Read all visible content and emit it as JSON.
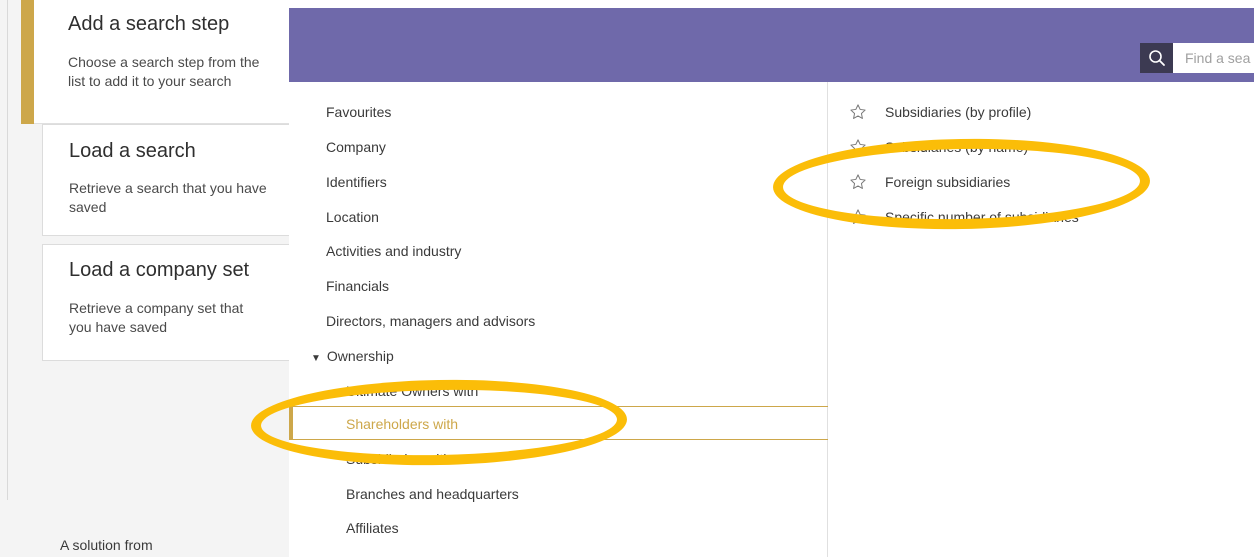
{
  "sidebar": {
    "add_step": {
      "title": "Add a search step",
      "description": "Choose a search step from the list to add it to your search"
    },
    "load_search": {
      "title": "Load a search",
      "description": "Retrieve a search that you have saved"
    },
    "load_company_set": {
      "title": "Load a company set",
      "description": "Retrieve a company set that you have saved"
    },
    "footer": "A solution from"
  },
  "header": {
    "search_placeholder": "Find a sea",
    "search_icon": "search-icon",
    "background": "#6f69aa"
  },
  "categories": {
    "items": [
      "Favourites",
      "Company",
      "Identifiers",
      "Location",
      "Activities and industry",
      "Financials",
      "Directors, managers and advisors"
    ],
    "expanded": "Ownership",
    "sub_items": [
      "Ultimate Owners with",
      "Shareholders with",
      "Subsidiaries with",
      "Branches and headquarters",
      "Affiliates"
    ],
    "selected": "Shareholders with",
    "accent": "#cda74a"
  },
  "options": {
    "items": [
      "Subsidiaries (by profile)",
      "Subsidiaries (by name)",
      "Foreign subsidiaries",
      "Specific number of subsidiaries"
    ],
    "icon": "star-outline-icon"
  },
  "annotation_color": "#fbbd08"
}
